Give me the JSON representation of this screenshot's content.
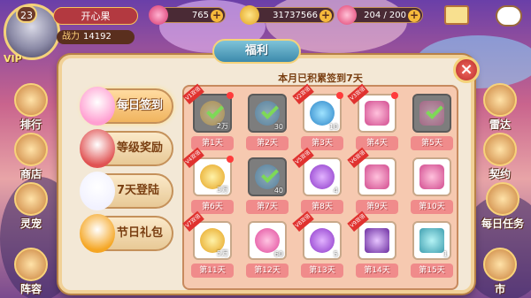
{
  "hud": {
    "level": "23",
    "vip": "VIP",
    "player_name": "开心果",
    "power_label": "战力",
    "power_value": "14192",
    "gems": "765",
    "coins": "31737566",
    "stamina": "204 / 200",
    "plus": "+"
  },
  "side_left": [
    "排行",
    "商店",
    "灵宠",
    "阵容"
  ],
  "side_right": [
    "雷达",
    "契约",
    "每日任务",
    "市"
  ],
  "dialog": {
    "title": "福利",
    "close": "×",
    "month_summary": "本月已积累签到7天"
  },
  "tabs": [
    {
      "label": "每日签到",
      "active": true,
      "icon": "fairy-girl-icon"
    },
    {
      "label": "等级奖励",
      "active": false,
      "icon": "red-hair-girl-icon"
    },
    {
      "label": "7天登陆",
      "active": false,
      "icon": "white-fairy-icon"
    },
    {
      "label": "节日礼包",
      "active": false,
      "icon": "pumpkin-girl-icon"
    }
  ],
  "days": [
    {
      "day": "第1天",
      "item": "coin",
      "qty": "2万",
      "vip": "V1双倍",
      "claimed": true,
      "dot": true
    },
    {
      "day": "第2天",
      "item": "candy",
      "qty": "30",
      "vip": "",
      "claimed": true,
      "dot": false
    },
    {
      "day": "第3天",
      "item": "candy",
      "qty": "10",
      "vip": "V2双倍",
      "claimed": false,
      "dot": true
    },
    {
      "day": "第4天",
      "item": "chair",
      "qty": "",
      "vip": "V3双倍",
      "claimed": false,
      "dot": true
    },
    {
      "day": "第5天",
      "item": "chair",
      "qty": "",
      "vip": "",
      "claimed": true,
      "dot": false
    },
    {
      "day": "第6天",
      "item": "coin",
      "qty": "3万",
      "vip": "V4双倍",
      "claimed": false,
      "dot": true
    },
    {
      "day": "第7天",
      "item": "candy",
      "qty": "40",
      "vip": "",
      "claimed": true,
      "dot": false
    },
    {
      "day": "第8天",
      "item": "purple",
      "qty": "4",
      "vip": "V5双倍",
      "claimed": false,
      "dot": false
    },
    {
      "day": "第9天",
      "item": "chair",
      "qty": "",
      "vip": "V6双倍",
      "claimed": false,
      "dot": false
    },
    {
      "day": "第10天",
      "item": "chair",
      "qty": "",
      "vip": "",
      "claimed": false,
      "dot": false
    },
    {
      "day": "第11天",
      "item": "coin",
      "qty": "5万",
      "vip": "V7双倍",
      "claimed": false,
      "dot": false
    },
    {
      "day": "第12天",
      "item": "heart",
      "qty": "60",
      "vip": "",
      "claimed": false,
      "dot": false
    },
    {
      "day": "第13天",
      "item": "purple",
      "qty": "5",
      "vip": "V8双倍",
      "claimed": false,
      "dot": false
    },
    {
      "day": "第14天",
      "item": "frame",
      "qty": "",
      "vip": "V9双倍",
      "claimed": false,
      "dot": false
    },
    {
      "day": "第15天",
      "item": "teal",
      "qty": "1",
      "vip": "",
      "claimed": false,
      "dot": false
    }
  ]
}
